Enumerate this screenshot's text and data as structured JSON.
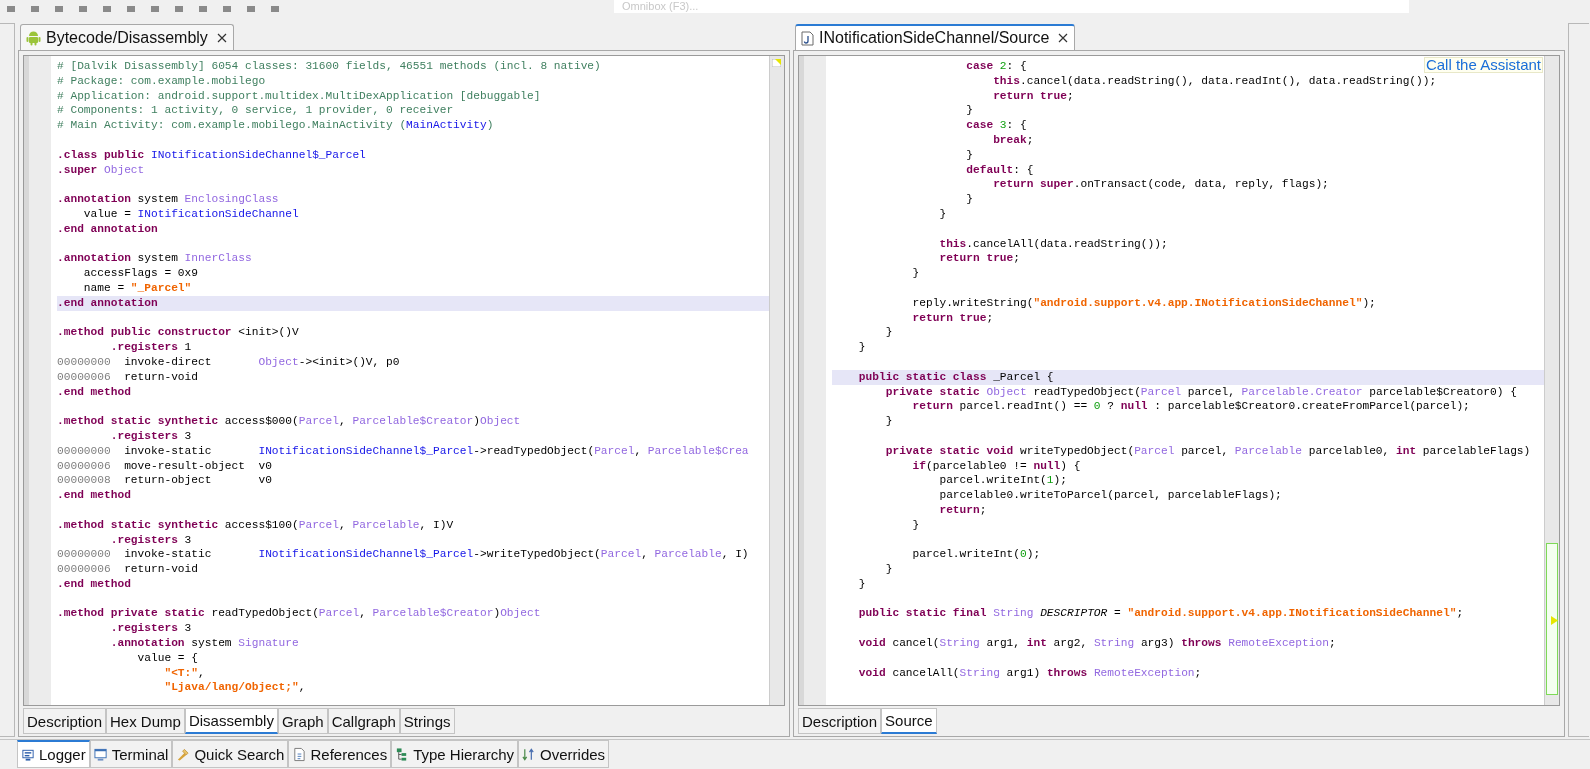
{
  "toolbar": {
    "omnibox": {
      "placeholder": "Omnibox (F3)..."
    }
  },
  "left_panel": {
    "tab": {
      "title": "Bytecode/Disassembly",
      "active": false
    },
    "lines": [
      {
        "kind": "code",
        "tokens": [
          {
            "kind": "comment",
            "text": "# [Dalvik Disassembly] 6054 classes: 31600 fields, 46551 methods (incl. 8 native)"
          }
        ]
      },
      {
        "kind": "code",
        "tokens": [
          {
            "kind": "comment",
            "text": "# Package: com.example.mobilego"
          }
        ]
      },
      {
        "kind": "code",
        "tokens": [
          {
            "kind": "comment",
            "text": "# Application: android.support.multidex.MultiDexApplication [debuggable]"
          }
        ]
      },
      {
        "kind": "code",
        "tokens": [
          {
            "kind": "comment",
            "text": "# Components: 1 activity, 0 service, 1 provider, 0 receiver"
          }
        ]
      },
      {
        "kind": "code",
        "tokens": [
          {
            "kind": "comment",
            "text": "# Main Activity: com.example.mobilego.MainActivity ("
          },
          {
            "kind": "class",
            "text": "MainActivity"
          },
          {
            "kind": "comment",
            "text": ")"
          }
        ]
      },
      {
        "kind": "blank"
      },
      {
        "kind": "code",
        "tokens": [
          {
            "kind": "keyword",
            "text": ".class public "
          },
          {
            "kind": "class",
            "text": "INotificationSideChannel$_Parcel"
          }
        ]
      },
      {
        "kind": "code",
        "tokens": [
          {
            "kind": "keyword",
            "text": ".super "
          },
          {
            "kind": "type",
            "text": "Object"
          }
        ]
      },
      {
        "kind": "blank"
      },
      {
        "kind": "code",
        "tokens": [
          {
            "kind": "keyword",
            "text": ".annotation "
          },
          {
            "kind": "plain",
            "text": "system "
          },
          {
            "kind": "type",
            "text": "EnclosingClass"
          }
        ]
      },
      {
        "kind": "code",
        "tokens": [
          {
            "kind": "plain",
            "text": "    value = "
          },
          {
            "kind": "class",
            "text": "INotificationSideChannel"
          }
        ]
      },
      {
        "kind": "code",
        "tokens": [
          {
            "kind": "keyword",
            "text": ".end annotation"
          }
        ]
      },
      {
        "kind": "blank"
      },
      {
        "kind": "code",
        "tokens": [
          {
            "kind": "keyword",
            "text": ".annotation "
          },
          {
            "kind": "plain",
            "text": "system "
          },
          {
            "kind": "type",
            "text": "InnerClass"
          }
        ]
      },
      {
        "kind": "code",
        "tokens": [
          {
            "kind": "plain",
            "text": "    accessFlags = 0x9"
          }
        ]
      },
      {
        "kind": "code",
        "tokens": [
          {
            "kind": "plain",
            "text": "    name = "
          },
          {
            "kind": "string",
            "text": "\"_Parcel\""
          }
        ]
      },
      {
        "kind": "code",
        "tokens": [
          {
            "kind": "keyword",
            "text": ".end annotation"
          }
        ],
        "highlighted": true
      },
      {
        "kind": "blank"
      },
      {
        "kind": "code",
        "tokens": [
          {
            "kind": "keyword",
            "text": ".method public constructor "
          },
          {
            "kind": "plain",
            "text": "<init>()V"
          }
        ]
      },
      {
        "kind": "code",
        "tokens": [
          {
            "kind": "keyword",
            "text": "        .registers "
          },
          {
            "kind": "plain",
            "text": "1"
          }
        ]
      },
      {
        "kind": "code",
        "tokens": [
          {
            "kind": "address",
            "text": "00000000"
          },
          {
            "kind": "plain",
            "text": "  invoke-direct       "
          },
          {
            "kind": "type",
            "text": "Object"
          },
          {
            "kind": "plain",
            "text": "-><init>()V, p0"
          }
        ]
      },
      {
        "kind": "code",
        "tokens": [
          {
            "kind": "address",
            "text": "00000006"
          },
          {
            "kind": "plain",
            "text": "  return-void"
          }
        ]
      },
      {
        "kind": "code",
        "tokens": [
          {
            "kind": "keyword",
            "text": ".end method"
          }
        ]
      },
      {
        "kind": "blank"
      },
      {
        "kind": "code",
        "tokens": [
          {
            "kind": "keyword",
            "text": ".method static synthetic "
          },
          {
            "kind": "plain",
            "text": "access$000("
          },
          {
            "kind": "type",
            "text": "Parcel"
          },
          {
            "kind": "plain",
            "text": ", "
          },
          {
            "kind": "type",
            "text": "Parcelable$Creator"
          },
          {
            "kind": "plain",
            "text": ")"
          },
          {
            "kind": "type",
            "text": "Object"
          }
        ]
      },
      {
        "kind": "code",
        "tokens": [
          {
            "kind": "keyword",
            "text": "        .registers "
          },
          {
            "kind": "plain",
            "text": "3"
          }
        ]
      },
      {
        "kind": "code",
        "tokens": [
          {
            "kind": "address",
            "text": "00000000"
          },
          {
            "kind": "plain",
            "text": "  invoke-static       "
          },
          {
            "kind": "class",
            "text": "INotificationSideChannel$_Parcel"
          },
          {
            "kind": "plain",
            "text": "->readTypedObject("
          },
          {
            "kind": "type",
            "text": "Parcel"
          },
          {
            "kind": "plain",
            "text": ", "
          },
          {
            "kind": "type",
            "text": "Parcelable$Crea"
          }
        ]
      },
      {
        "kind": "code",
        "tokens": [
          {
            "kind": "address",
            "text": "00000006"
          },
          {
            "kind": "plain",
            "text": "  move-result-object  v0"
          }
        ]
      },
      {
        "kind": "code",
        "tokens": [
          {
            "kind": "address",
            "text": "00000008"
          },
          {
            "kind": "plain",
            "text": "  return-object       v0"
          }
        ]
      },
      {
        "kind": "code",
        "tokens": [
          {
            "kind": "keyword",
            "text": ".end method"
          }
        ]
      },
      {
        "kind": "blank"
      },
      {
        "kind": "code",
        "tokens": [
          {
            "kind": "keyword",
            "text": ".method static synthetic "
          },
          {
            "kind": "plain",
            "text": "access$100("
          },
          {
            "kind": "type",
            "text": "Parcel"
          },
          {
            "kind": "plain",
            "text": ", "
          },
          {
            "kind": "type",
            "text": "Parcelable"
          },
          {
            "kind": "plain",
            "text": ", I)V"
          }
        ]
      },
      {
        "kind": "code",
        "tokens": [
          {
            "kind": "keyword",
            "text": "        .registers "
          },
          {
            "kind": "plain",
            "text": "3"
          }
        ]
      },
      {
        "kind": "code",
        "tokens": [
          {
            "kind": "address",
            "text": "00000000"
          },
          {
            "kind": "plain",
            "text": "  invoke-static       "
          },
          {
            "kind": "class",
            "text": "INotificationSideChannel$_Parcel"
          },
          {
            "kind": "plain",
            "text": "->writeTypedObject("
          },
          {
            "kind": "type",
            "text": "Parcel"
          },
          {
            "kind": "plain",
            "text": ", "
          },
          {
            "kind": "type",
            "text": "Parcelable"
          },
          {
            "kind": "plain",
            "text": ", I)"
          }
        ]
      },
      {
        "kind": "code",
        "tokens": [
          {
            "kind": "address",
            "text": "00000006"
          },
          {
            "kind": "plain",
            "text": "  return-void"
          }
        ]
      },
      {
        "kind": "code",
        "tokens": [
          {
            "kind": "keyword",
            "text": ".end method"
          }
        ]
      },
      {
        "kind": "blank"
      },
      {
        "kind": "code",
        "tokens": [
          {
            "kind": "keyword",
            "text": ".method private static "
          },
          {
            "kind": "plain",
            "text": "readTypedObject("
          },
          {
            "kind": "type",
            "text": "Parcel"
          },
          {
            "kind": "plain",
            "text": ", "
          },
          {
            "kind": "type",
            "text": "Parcelable$Creator"
          },
          {
            "kind": "plain",
            "text": ")"
          },
          {
            "kind": "type",
            "text": "Object"
          }
        ]
      },
      {
        "kind": "code",
        "tokens": [
          {
            "kind": "keyword",
            "text": "        .registers "
          },
          {
            "kind": "plain",
            "text": "3"
          }
        ]
      },
      {
        "kind": "code",
        "tokens": [
          {
            "kind": "keyword",
            "text": "        .annotation "
          },
          {
            "kind": "plain",
            "text": "system "
          },
          {
            "kind": "type",
            "text": "Signature"
          }
        ]
      },
      {
        "kind": "code",
        "tokens": [
          {
            "kind": "plain",
            "text": "            value = {"
          }
        ]
      },
      {
        "kind": "code",
        "tokens": [
          {
            "kind": "string",
            "text": "                \"<T:\""
          },
          {
            "kind": "plain",
            "text": ","
          }
        ]
      },
      {
        "kind": "code",
        "tokens": [
          {
            "kind": "string",
            "text": "                \"Ljava/lang/Object;\""
          },
          {
            "kind": "plain",
            "text": ","
          }
        ]
      }
    ],
    "bottom_tabs": [
      {
        "label": "Description",
        "selected": false
      },
      {
        "label": "Hex Dump",
        "selected": false
      },
      {
        "label": "Disassembly",
        "selected": true
      },
      {
        "label": "Graph",
        "selected": false
      },
      {
        "label": "Callgraph",
        "selected": false
      },
      {
        "label": "Strings",
        "selected": false
      }
    ]
  },
  "right_panel": {
    "tab": {
      "title": "INotificationSideChannel/Source",
      "active": true
    },
    "tooltip": "Call the Assistant",
    "lines": [
      {
        "kind": "code",
        "tokens": [
          {
            "kind": "keyword",
            "text": "                    case "
          },
          {
            "kind": "number",
            "text": "2"
          },
          {
            "kind": "plain",
            "text": ": {"
          }
        ]
      },
      {
        "kind": "code",
        "tokens": [
          {
            "kind": "keyword",
            "text": "                        this"
          },
          {
            "kind": "plain",
            "text": ".cancel(data.readString(), data.readInt(), data.readString());"
          }
        ]
      },
      {
        "kind": "code",
        "tokens": [
          {
            "kind": "keyword",
            "text": "                        return true"
          },
          {
            "kind": "plain",
            "text": ";"
          }
        ]
      },
      {
        "kind": "code",
        "tokens": [
          {
            "kind": "plain",
            "text": "                    }"
          }
        ]
      },
      {
        "kind": "code",
        "tokens": [
          {
            "kind": "keyword",
            "text": "                    case "
          },
          {
            "kind": "number",
            "text": "3"
          },
          {
            "kind": "plain",
            "text": ": {"
          }
        ]
      },
      {
        "kind": "code",
        "tokens": [
          {
            "kind": "keyword",
            "text": "                        break"
          },
          {
            "kind": "plain",
            "text": ";"
          }
        ]
      },
      {
        "kind": "code",
        "tokens": [
          {
            "kind": "plain",
            "text": "                    }"
          }
        ]
      },
      {
        "kind": "code",
        "tokens": [
          {
            "kind": "keyword",
            "text": "                    default"
          },
          {
            "kind": "plain",
            "text": ": {"
          }
        ]
      },
      {
        "kind": "code",
        "tokens": [
          {
            "kind": "keyword",
            "text": "                        return super"
          },
          {
            "kind": "plain",
            "text": ".onTransact(code, data, reply, flags);"
          }
        ]
      },
      {
        "kind": "code",
        "tokens": [
          {
            "kind": "plain",
            "text": "                    }"
          }
        ]
      },
      {
        "kind": "code",
        "tokens": [
          {
            "kind": "plain",
            "text": "                }"
          }
        ]
      },
      {
        "kind": "blank"
      },
      {
        "kind": "code",
        "tokens": [
          {
            "kind": "keyword",
            "text": "                this"
          },
          {
            "kind": "plain",
            "text": ".cancelAll(data.readString());"
          }
        ]
      },
      {
        "kind": "code",
        "tokens": [
          {
            "kind": "keyword",
            "text": "                return true"
          },
          {
            "kind": "plain",
            "text": ";"
          }
        ]
      },
      {
        "kind": "code",
        "tokens": [
          {
            "kind": "plain",
            "text": "            }"
          }
        ]
      },
      {
        "kind": "blank"
      },
      {
        "kind": "code",
        "tokens": [
          {
            "kind": "plain",
            "text": "            reply.writeString("
          },
          {
            "kind": "string",
            "text": "\"android.support.v4.app.INotificationSideChannel\""
          },
          {
            "kind": "plain",
            "text": ");"
          }
        ]
      },
      {
        "kind": "code",
        "tokens": [
          {
            "kind": "keyword",
            "text": "            return true"
          },
          {
            "kind": "plain",
            "text": ";"
          }
        ]
      },
      {
        "kind": "code",
        "tokens": [
          {
            "kind": "plain",
            "text": "        }"
          }
        ]
      },
      {
        "kind": "code",
        "tokens": [
          {
            "kind": "plain",
            "text": "    }"
          }
        ]
      },
      {
        "kind": "blank"
      },
      {
        "kind": "code",
        "tokens": [
          {
            "kind": "keyword",
            "text": "    public static class "
          },
          {
            "kind": "plain",
            "text": "_Parcel {"
          }
        ],
        "highlighted": true
      },
      {
        "kind": "code",
        "tokens": [
          {
            "kind": "keyword",
            "text": "        private static "
          },
          {
            "kind": "type",
            "text": "Object"
          },
          {
            "kind": "plain",
            "text": " readTypedObject("
          },
          {
            "kind": "type",
            "text": "Parcel"
          },
          {
            "kind": "plain",
            "text": " parcel, "
          },
          {
            "kind": "type",
            "text": "Parcelable.Creator"
          },
          {
            "kind": "plain",
            "text": " parcelable$Creator0) {"
          }
        ]
      },
      {
        "kind": "code",
        "tokens": [
          {
            "kind": "keyword",
            "text": "            return "
          },
          {
            "kind": "plain",
            "text": "parcel.readInt() == "
          },
          {
            "kind": "number",
            "text": "0"
          },
          {
            "kind": "plain",
            "text": " ? "
          },
          {
            "kind": "keyword",
            "text": "null"
          },
          {
            "kind": "plain",
            "text": " : parcelable$Creator0.createFromParcel(parcel);"
          }
        ]
      },
      {
        "kind": "code",
        "tokens": [
          {
            "kind": "plain",
            "text": "        }"
          }
        ]
      },
      {
        "kind": "blank"
      },
      {
        "kind": "code",
        "tokens": [
          {
            "kind": "keyword",
            "text": "        private static void "
          },
          {
            "kind": "plain",
            "text": "writeTypedObject("
          },
          {
            "kind": "type",
            "text": "Parcel"
          },
          {
            "kind": "plain",
            "text": " parcel, "
          },
          {
            "kind": "type",
            "text": "Parcelable"
          },
          {
            "kind": "plain",
            "text": " parcelable0, "
          },
          {
            "kind": "keyword",
            "text": "int "
          },
          {
            "kind": "plain",
            "text": "parcelableFlags)"
          }
        ]
      },
      {
        "kind": "code",
        "tokens": [
          {
            "kind": "keyword",
            "text": "            if"
          },
          {
            "kind": "plain",
            "text": "(parcelable0 != "
          },
          {
            "kind": "keyword",
            "text": "null"
          },
          {
            "kind": "plain",
            "text": ") {"
          }
        ]
      },
      {
        "kind": "code",
        "tokens": [
          {
            "kind": "plain",
            "text": "                parcel.writeInt("
          },
          {
            "kind": "number",
            "text": "1"
          },
          {
            "kind": "plain",
            "text": ");"
          }
        ]
      },
      {
        "kind": "code",
        "tokens": [
          {
            "kind": "plain",
            "text": "                parcelable0.writeToParcel(parcel, parcelableFlags);"
          }
        ]
      },
      {
        "kind": "code",
        "tokens": [
          {
            "kind": "keyword",
            "text": "                return"
          },
          {
            "kind": "plain",
            "text": ";"
          }
        ]
      },
      {
        "kind": "code",
        "tokens": [
          {
            "kind": "plain",
            "text": "            }"
          }
        ]
      },
      {
        "kind": "blank"
      },
      {
        "kind": "code",
        "tokens": [
          {
            "kind": "plain",
            "text": "            parcel.writeInt("
          },
          {
            "kind": "number",
            "text": "0"
          },
          {
            "kind": "plain",
            "text": ");"
          }
        ]
      },
      {
        "kind": "code",
        "tokens": [
          {
            "kind": "plain",
            "text": "        }"
          }
        ]
      },
      {
        "kind": "code",
        "tokens": [
          {
            "kind": "plain",
            "text": "    }"
          }
        ]
      },
      {
        "kind": "blank"
      },
      {
        "kind": "code",
        "tokens": [
          {
            "kind": "keyword",
            "text": "    public static final "
          },
          {
            "kind": "type",
            "text": "String "
          },
          {
            "kind": "constant",
            "text": "DESCRIPTOR"
          },
          {
            "kind": "plain",
            "text": " = "
          },
          {
            "kind": "string",
            "text": "\"android.support.v4.app.INotificationSideChannel\""
          },
          {
            "kind": "plain",
            "text": ";"
          }
        ]
      },
      {
        "kind": "blank"
      },
      {
        "kind": "code",
        "tokens": [
          {
            "kind": "keyword",
            "text": "    void "
          },
          {
            "kind": "plain",
            "text": "cancel("
          },
          {
            "kind": "type",
            "text": "String"
          },
          {
            "kind": "plain",
            "text": " arg1, "
          },
          {
            "kind": "keyword",
            "text": "int "
          },
          {
            "kind": "plain",
            "text": "arg2, "
          },
          {
            "kind": "type",
            "text": "String"
          },
          {
            "kind": "plain",
            "text": " arg3) "
          },
          {
            "kind": "keyword",
            "text": "throws "
          },
          {
            "kind": "type",
            "text": "RemoteException"
          },
          {
            "kind": "plain",
            "text": ";"
          }
        ]
      },
      {
        "kind": "blank"
      },
      {
        "kind": "code",
        "tokens": [
          {
            "kind": "keyword",
            "text": "    void "
          },
          {
            "kind": "plain",
            "text": "cancelAll("
          },
          {
            "kind": "type",
            "text": "String"
          },
          {
            "kind": "plain",
            "text": " arg1) "
          },
          {
            "kind": "keyword",
            "text": "throws "
          },
          {
            "kind": "type",
            "text": "RemoteException"
          },
          {
            "kind": "plain",
            "text": ";"
          }
        ]
      }
    ],
    "bottom_tabs": [
      {
        "label": "Description",
        "selected": false
      },
      {
        "label": "Source",
        "selected": true
      }
    ]
  },
  "bottom_bar": {
    "tabs": [
      {
        "label": "Logger",
        "selected": true
      },
      {
        "label": "Terminal",
        "selected": false
      },
      {
        "label": "Quick Search",
        "selected": false
      },
      {
        "label": "References",
        "selected": false
      },
      {
        "label": "Type Hierarchy",
        "selected": false
      },
      {
        "label": "Overrides",
        "selected": false
      }
    ]
  }
}
